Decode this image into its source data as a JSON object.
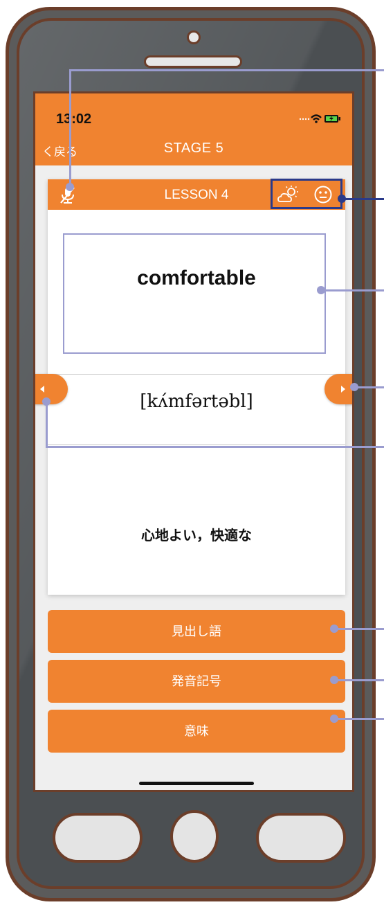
{
  "status_bar": {
    "time": "13:02"
  },
  "nav": {
    "back_label": "く戻る",
    "title": "STAGE 5"
  },
  "card": {
    "lesson_title": "LESSON 4",
    "word": "comfortable",
    "phonetic": "[kʌ́mfərtəbl]",
    "meaning": "心地よい，快適な"
  },
  "buttons": [
    {
      "label": "見出し語"
    },
    {
      "label": "発音記号"
    },
    {
      "label": "意味"
    }
  ],
  "icons": [
    "mic-off-icon",
    "weather-icon",
    "face-icon",
    "arrow-left-icon",
    "arrow-right-icon",
    "wifi-icon",
    "battery-icon"
  ],
  "colors": {
    "accent": "#f08330",
    "callout": "#9a9ccf",
    "callout_dark": "#2a3a8a"
  }
}
